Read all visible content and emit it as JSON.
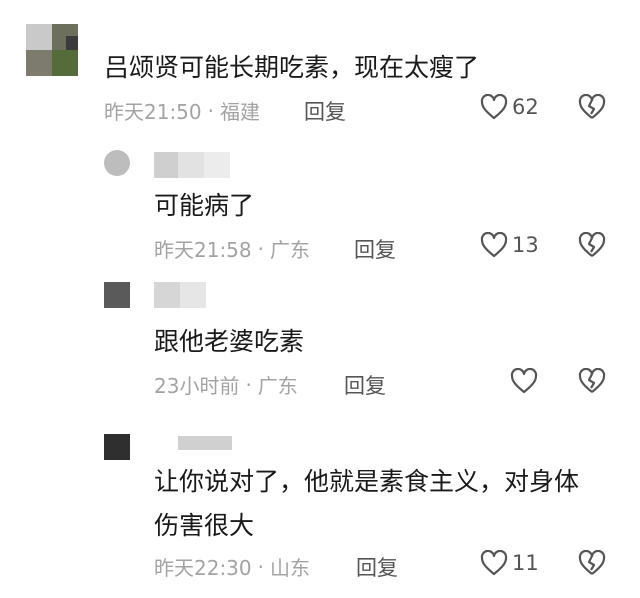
{
  "comments": [
    {
      "text": "吕颂贤可能长期吃素，现在太瘦了",
      "time": "昨天21:50",
      "location": "福建",
      "reply_label": "回复",
      "likes": "62"
    },
    {
      "text": "可能病了",
      "time": "昨天21:58",
      "location": "广东",
      "reply_label": "回复",
      "likes": "13"
    },
    {
      "text": "跟他老婆吃素",
      "time": "23小时前",
      "location": "广东",
      "reply_label": "回复",
      "likes": ""
    },
    {
      "text_line1": "让你说对了，他就是素食主义，对身体",
      "text_line2": "伤害很大",
      "time": "昨天22:30",
      "location": "山东",
      "reply_label": "回复",
      "likes": "11"
    }
  ],
  "separator": "·",
  "icons": {
    "like": "heart-outline-icon",
    "dislike": "broken-heart-icon"
  }
}
